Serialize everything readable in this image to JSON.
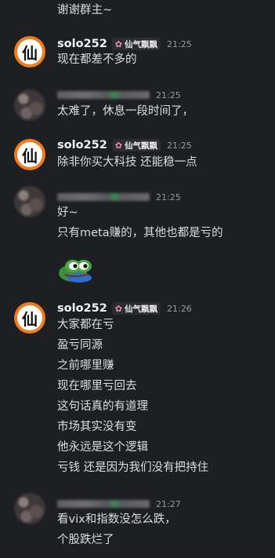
{
  "top_fragment": "谢谢群主~",
  "messages": [
    {
      "username": "solo252",
      "badge": "仙气飘飘",
      "time": "21:25",
      "lines": [
        "现在都差不多的"
      ]
    },
    {
      "username": "",
      "badge": "",
      "time": "21:25",
      "lines": [
        "太难了，休息一段时间了，"
      ]
    },
    {
      "username": "solo252",
      "badge": "仙气飘飘",
      "time": "21:25",
      "lines": [
        "除非你买大科技 还能稳一点"
      ]
    },
    {
      "username": "",
      "badge": "",
      "time": "21:25",
      "lines": [
        "好~",
        "只有meta赚的，其他也都是亏的"
      ]
    },
    {
      "username": "solo252",
      "badge": "仙气飘飘",
      "time": "21:26",
      "lines": [
        "大家都在亏",
        "盈亏同源",
        "之前哪里赚",
        "现在哪里亏回去",
        "这句话真的有道理",
        "市场其实没有变",
        "他永远是这个逻辑",
        "亏钱 还是因为我们没有把持住"
      ]
    },
    {
      "username": "",
      "badge": "",
      "time": "21:27",
      "lines": [
        "看vix和指数没怎么跌，",
        "个股跌烂了"
      ]
    }
  ],
  "avatar_glyph": "仙",
  "colors": {
    "background": "#1e1f22",
    "text": "#dbdee1",
    "timestamp": "#949ba4",
    "avatar_ring": "#f07c1c"
  },
  "icons": {
    "badge": "flower-icon",
    "emoji": "pepe-frog-emoji"
  }
}
